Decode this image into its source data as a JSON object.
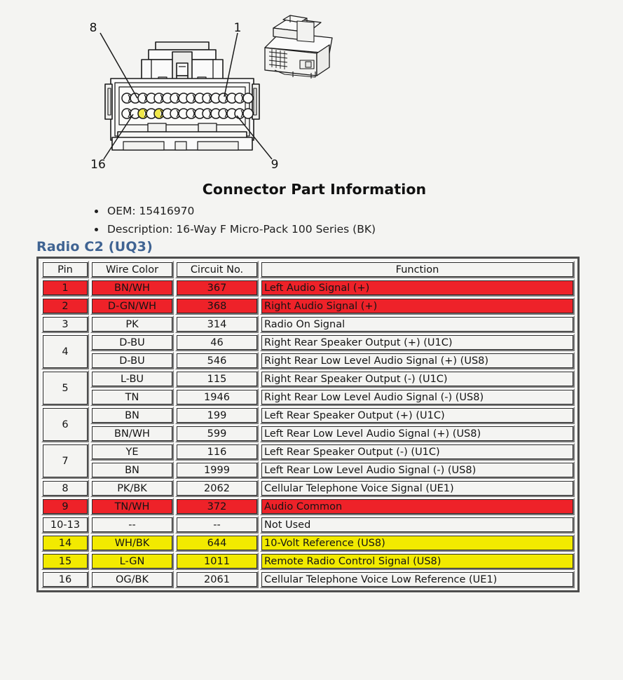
{
  "diagram": {
    "name": "connector-face-diagram",
    "callouts": [
      {
        "label": "8",
        "position": "top-left"
      },
      {
        "label": "1",
        "position": "top-right"
      },
      {
        "label": "16",
        "position": "bottom-left"
      },
      {
        "label": "9",
        "position": "bottom-right"
      }
    ],
    "cavity_rows": 2,
    "cavities_per_row": 8,
    "highlighted_cavities": [
      "bottom-2",
      "bottom-3"
    ],
    "highlight_color": "#f0e84a",
    "inset_view": "isometric-connector-body"
  },
  "part_info": {
    "title": "Connector Part Information",
    "items": [
      "OEM: 15416970",
      "Description: 16-Way F Micro-Pack 100 Series (BK)"
    ]
  },
  "section": {
    "heading": "Radio C2 (UQ3)",
    "heading_color": "#3f6392"
  },
  "table": {
    "columns": [
      "Pin",
      "Wire Color",
      "Circuit No.",
      "Function"
    ],
    "highlight_colors": {
      "red": "#ee2229",
      "yellow": "#f2ea00"
    },
    "rows": [
      {
        "pin": "1",
        "pin_rowspan": 1,
        "wire": "BN/WH",
        "circuit": "367",
        "function": "Left Audio Signal (+)",
        "highlight": "red"
      },
      {
        "pin": "2",
        "pin_rowspan": 1,
        "wire": "D-GN/WH",
        "circuit": "368",
        "function": "Right Audio Signal (+)",
        "highlight": "red"
      },
      {
        "pin": "3",
        "pin_rowspan": 1,
        "wire": "PK",
        "circuit": "314",
        "function": "Radio On Signal",
        "highlight": "none"
      },
      {
        "pin": "4",
        "pin_rowspan": 2,
        "wire": "D-BU",
        "circuit": "46",
        "function": "Right Rear Speaker Output (+) (U1C)",
        "highlight": "none"
      },
      {
        "pin": null,
        "pin_rowspan": 0,
        "wire": "D-BU",
        "circuit": "546",
        "function": "Right Rear Low Level Audio Signal (+) (US8)",
        "highlight": "none"
      },
      {
        "pin": "5",
        "pin_rowspan": 2,
        "wire": "L-BU",
        "circuit": "115",
        "function": "Right Rear Speaker Output (-) (U1C)",
        "highlight": "none"
      },
      {
        "pin": null,
        "pin_rowspan": 0,
        "wire": "TN",
        "circuit": "1946",
        "function": "Right Rear Low Level Audio Signal (-) (US8)",
        "highlight": "none"
      },
      {
        "pin": "6",
        "pin_rowspan": 2,
        "wire": "BN",
        "circuit": "199",
        "function": "Left Rear Speaker Output (+) (U1C)",
        "highlight": "none"
      },
      {
        "pin": null,
        "pin_rowspan": 0,
        "wire": "BN/WH",
        "circuit": "599",
        "function": "Left Rear Low Level Audio Signal (+) (US8)",
        "highlight": "none"
      },
      {
        "pin": "7",
        "pin_rowspan": 2,
        "wire": "YE",
        "circuit": "116",
        "function": "Left Rear Speaker Output (-) (U1C)",
        "highlight": "none"
      },
      {
        "pin": null,
        "pin_rowspan": 0,
        "wire": "BN",
        "circuit": "1999",
        "function": "Left Rear Low Level Audio Signal (-) (US8)",
        "highlight": "none"
      },
      {
        "pin": "8",
        "pin_rowspan": 1,
        "wire": "PK/BK",
        "circuit": "2062",
        "function": "Cellular Telephone Voice Signal (UE1)",
        "highlight": "none"
      },
      {
        "pin": "9",
        "pin_rowspan": 1,
        "wire": "TN/WH",
        "circuit": "372",
        "function": "Audio Common",
        "highlight": "red"
      },
      {
        "pin": "10-13",
        "pin_rowspan": 1,
        "wire": "--",
        "circuit": "--",
        "function": "Not Used",
        "highlight": "none"
      },
      {
        "pin": "14",
        "pin_rowspan": 1,
        "wire": "WH/BK",
        "circuit": "644",
        "function": "10-Volt Reference (US8)",
        "highlight": "yellow"
      },
      {
        "pin": "15",
        "pin_rowspan": 1,
        "wire": "L-GN",
        "circuit": "1011",
        "function": "Remote Radio Control Signal (US8)",
        "highlight": "yellow"
      },
      {
        "pin": "16",
        "pin_rowspan": 1,
        "wire": "OG/BK",
        "circuit": "2061",
        "function": "Cellular Telephone Voice Low Reference (UE1)",
        "highlight": "none"
      }
    ]
  }
}
